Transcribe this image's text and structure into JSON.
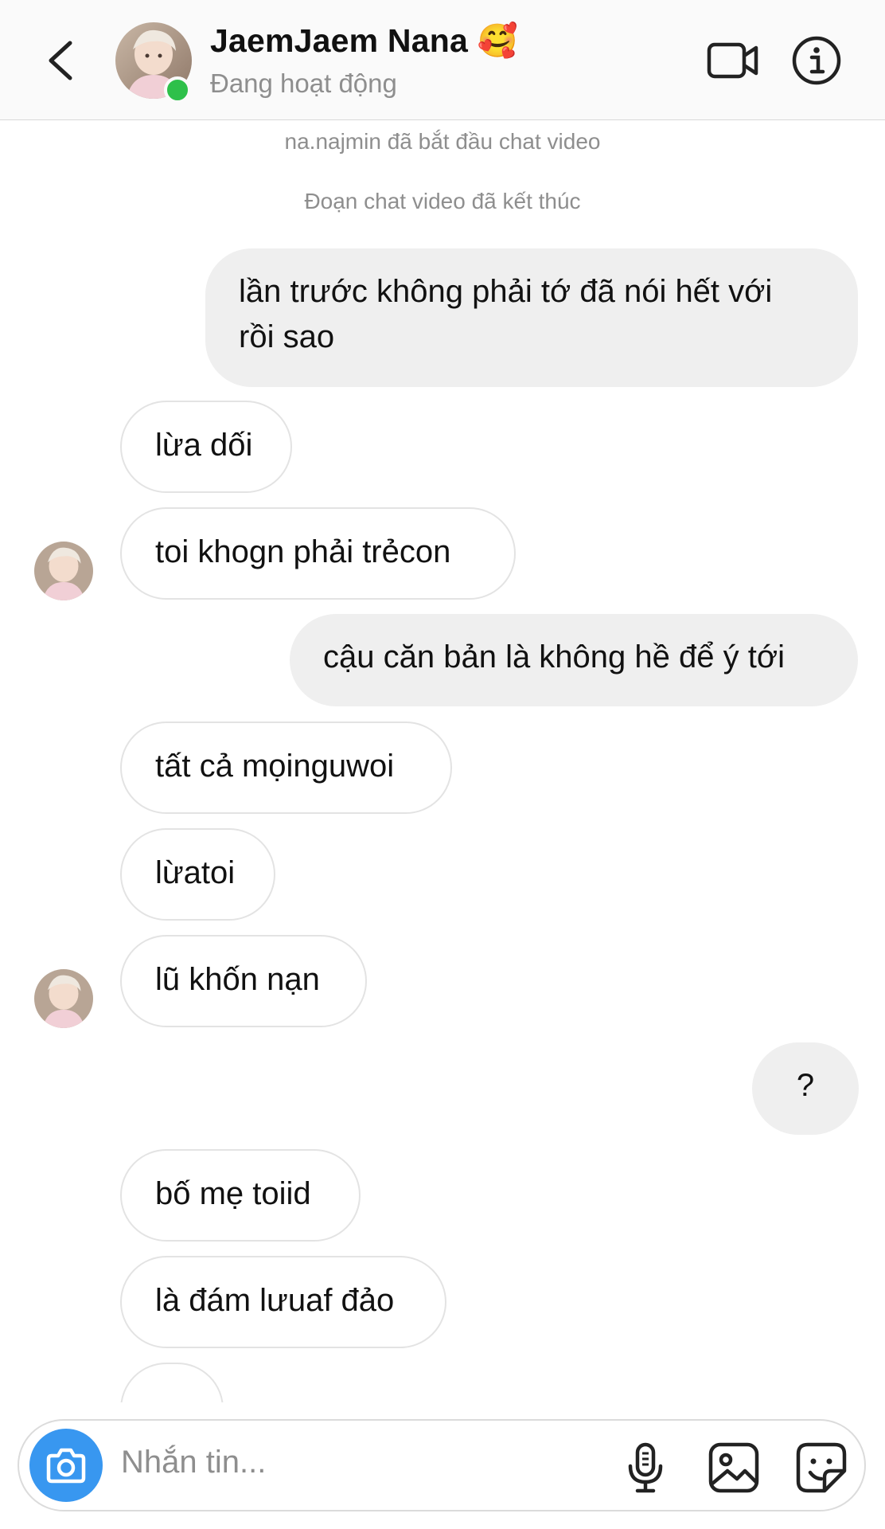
{
  "header": {
    "contact_name": "JaemJaem Nana 🥰",
    "status": "Đang hoạt động"
  },
  "notices": [
    "na.najmin đã bắt đầu chat video",
    "Đoạn chat video đã kết thúc"
  ],
  "messages": [
    {
      "from": "me",
      "line1": "lần trước không phải tớ đã nói hết với",
      "line2": "rồi sao"
    },
    {
      "from": "them",
      "text": "lừa dối"
    },
    {
      "from": "them",
      "text": "toi khogn phải trẻcon"
    },
    {
      "from": "me",
      "text": "cậu căn bản là không hề để ý tới"
    },
    {
      "from": "them",
      "text": "tất cả mọinguwoi"
    },
    {
      "from": "them",
      "text": "lừatoi"
    },
    {
      "from": "them",
      "text": "lũ khốn nạn"
    },
    {
      "from": "me",
      "text": "?"
    },
    {
      "from": "them",
      "text": "bố mẹ toiid"
    },
    {
      "from": "them",
      "text": "là đám lưuaf đảo"
    }
  ],
  "composer": {
    "placeholder": "Nhắn tin..."
  },
  "colors": {
    "accent": "#3897f0",
    "online": "#2ec04a",
    "outgoing_bubble": "#efefef",
    "muted_text": "#8e8e8e"
  },
  "icons": [
    "back-arrow-icon",
    "video-call-icon",
    "info-icon",
    "camera-icon",
    "microphone-icon",
    "gallery-icon",
    "sticker-icon"
  ]
}
